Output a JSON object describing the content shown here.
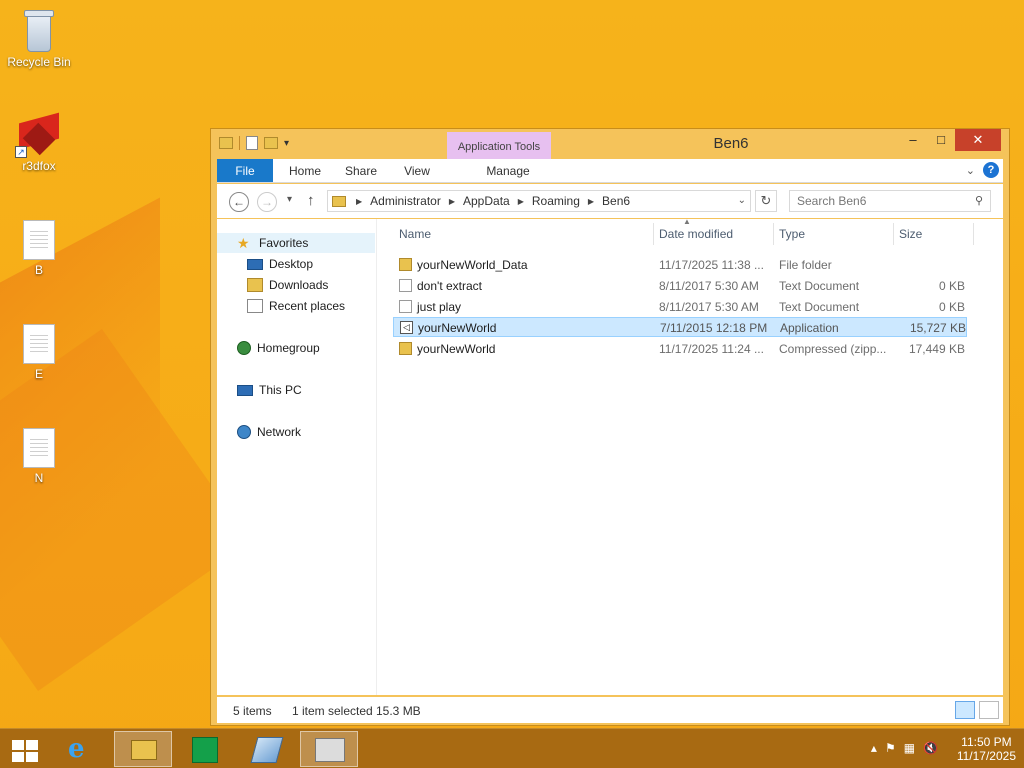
{
  "desktop": {
    "icons": [
      {
        "label": "Recycle Bin",
        "icon": "recycle-bin-icon"
      },
      {
        "label": "r3dfox",
        "icon": "r3dfox-icon"
      },
      {
        "label": "B",
        "icon": "text-document-icon"
      },
      {
        "label": "E",
        "icon": "text-document-icon"
      },
      {
        "label": "N",
        "icon": "text-document-icon"
      }
    ]
  },
  "window": {
    "title": "Ben6",
    "contextual_tab_group": "Application Tools",
    "ribbon_tabs": [
      "File",
      "Home",
      "Share",
      "View",
      "Manage"
    ],
    "controls": {
      "minimize": "–",
      "maximize": "□",
      "close": "✕"
    },
    "help_label": "?"
  },
  "address": {
    "breadcrumbs": [
      "Administrator",
      "AppData",
      "Roaming",
      "Ben6"
    ],
    "search_placeholder": "Search Ben6"
  },
  "nav_pane": {
    "favorites": {
      "label": "Favorites",
      "items": [
        "Desktop",
        "Downloads",
        "Recent places"
      ]
    },
    "homegroup": "Homegroup",
    "this_pc": "This PC",
    "network": "Network"
  },
  "file_list": {
    "columns": [
      "Name",
      "Date modified",
      "Type",
      "Size"
    ],
    "rows": [
      {
        "name": "yourNewWorld_Data",
        "date": "11/17/2025 11:38 ...",
        "type": "File folder",
        "size": "",
        "icon": "folder-icon",
        "selected": false
      },
      {
        "name": "don't extract",
        "date": "8/11/2017 5:30 AM",
        "type": "Text Document",
        "size": "0 KB",
        "icon": "text-file-icon",
        "selected": false
      },
      {
        "name": "just play",
        "date": "8/11/2017 5:30 AM",
        "type": "Text Document",
        "size": "0 KB",
        "icon": "text-file-icon",
        "selected": false
      },
      {
        "name": "yourNewWorld",
        "date": "7/11/2015 12:18 PM",
        "type": "Application",
        "size": "15,727 KB",
        "icon": "application-icon",
        "selected": true
      },
      {
        "name": "yourNewWorld",
        "date": "11/17/2025 11:24 ...",
        "type": "Compressed (zipp...",
        "size": "17,449 KB",
        "icon": "zip-folder-icon",
        "selected": false
      }
    ]
  },
  "status_bar": {
    "item_count": "5 items",
    "selection": "1 item selected",
    "selection_size": "15.3 MB"
  },
  "taskbar": {
    "apps": [
      "internet-explorer-icon",
      "file-explorer-icon",
      "store-icon",
      "app-icon",
      "app-icon"
    ],
    "time": "11:50 PM",
    "date": "11/17/2025"
  },
  "colors": {
    "desktop_background": "#f6b31b",
    "window_frame": "#f5c35a",
    "file_tab": "#1979ca",
    "application_tools": "#e7c0f0",
    "selection": "#cce8ff",
    "close_button": "#c7412a"
  }
}
